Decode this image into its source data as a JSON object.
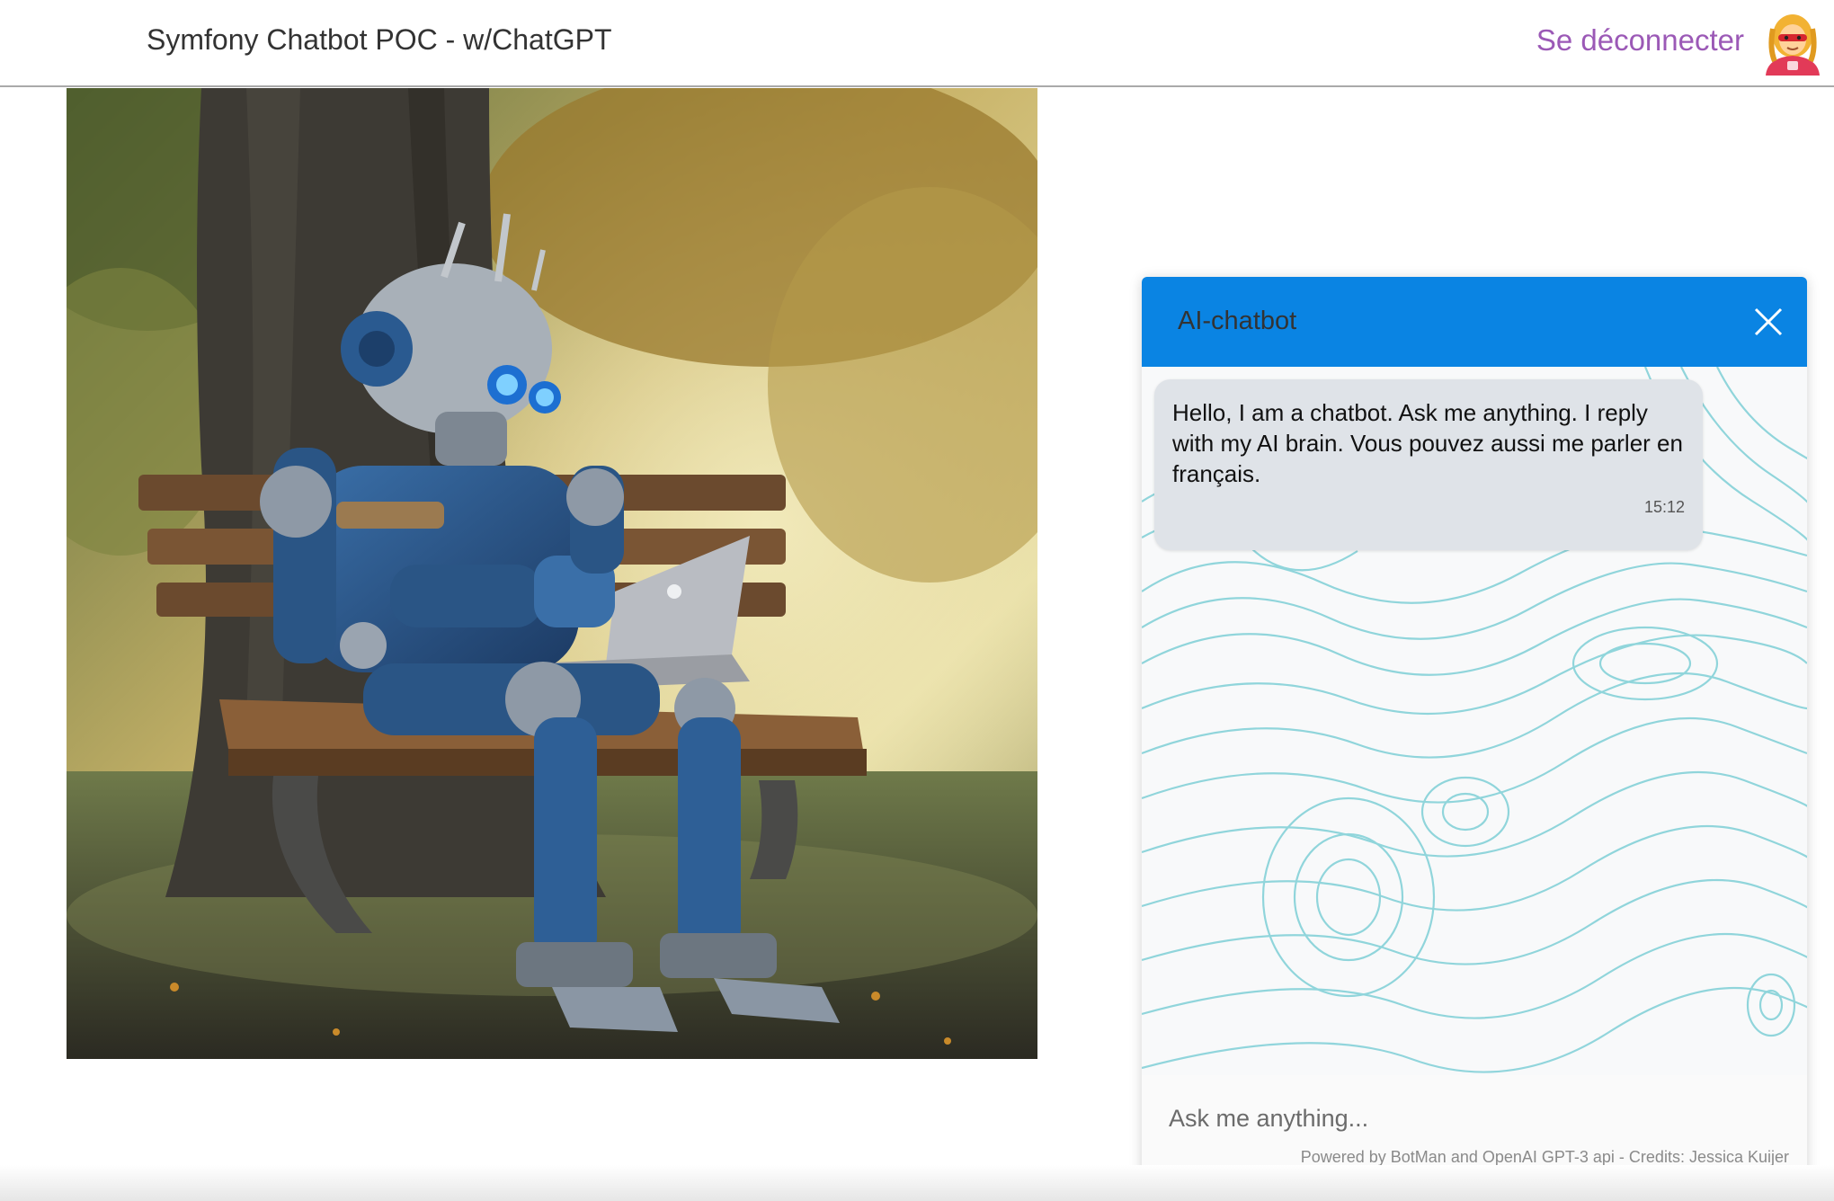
{
  "navbar": {
    "title": "Symfony Chatbot POC - w/ChatGPT",
    "logout_label": "Se déconnecter",
    "avatar_icon": "superhero-woman-icon"
  },
  "hero_image": {
    "icon": "robot-on-bench-illustration"
  },
  "chat": {
    "title": "AI-chatbot",
    "close_icon": "close-icon",
    "header_color": "#0a84e3",
    "messages": [
      {
        "text": "Hello, I am a chatbot. Ask me anything. I reply with my AI brain. Vous pouvez aussi me parler en français.",
        "time": "15:12"
      }
    ],
    "input_placeholder": "Ask me anything...",
    "credits": "Powered by BotMan and OpenAI GPT-3 api - Credits: Jessica Kuijer"
  },
  "colors": {
    "accent": "#0a84e3",
    "logout": "#9b59b6",
    "bubble": "#dfe3e8",
    "topo_lines": "#7fcfd6"
  }
}
